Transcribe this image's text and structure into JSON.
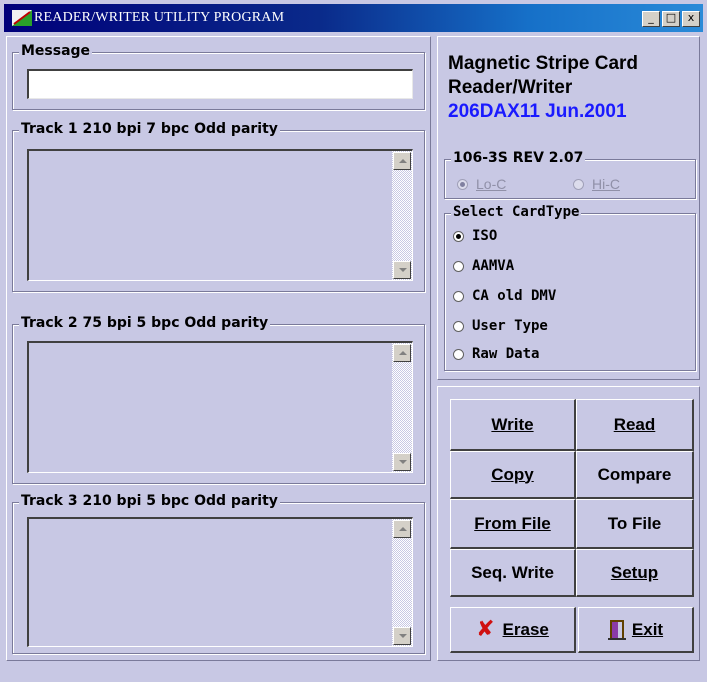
{
  "window": {
    "title": "READER/WRITER UTILITY PROGRAM",
    "min": "_",
    "max": "□",
    "close": "x"
  },
  "message": {
    "label": "Message",
    "value": ""
  },
  "tracks": [
    {
      "label": "Track 1  210 bpi  7 bpc  Odd parity",
      "value": ""
    },
    {
      "label": "Track 2  75 bpi  5 bpc  Odd parity",
      "value": ""
    },
    {
      "label": "Track 3  210 bpi  5 bpc  Odd parity",
      "value": ""
    }
  ],
  "info": {
    "line1": "Magnetic Stripe Card",
    "line2": "Reader/Writer",
    "line3": "206DAX11 Jun.2001",
    "line3_color": "#1a1aff"
  },
  "coercivity": {
    "label": "106-3S  REV 2.07",
    "lo": "Lo-C",
    "hi": "Hi-C",
    "selected": "Lo-C"
  },
  "cardtype": {
    "label": "Select CardType",
    "options": [
      "ISO",
      "AAMVA",
      "CA old DMV",
      "User Type",
      "Raw Data"
    ],
    "selected": "ISO"
  },
  "buttons": {
    "write": "Write",
    "read": "Read",
    "copy": "Copy",
    "compare": "Compare",
    "from_file": "From File",
    "to_file": "To File",
    "seq_write": "Seq. Write",
    "setup": "Setup",
    "erase": "Erase",
    "exit": "Exit"
  }
}
